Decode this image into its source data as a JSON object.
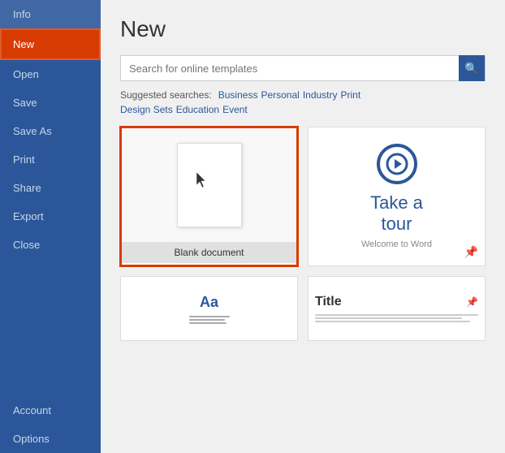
{
  "sidebar": {
    "items": [
      {
        "id": "info",
        "label": "Info",
        "active": false
      },
      {
        "id": "new",
        "label": "New",
        "active": true
      },
      {
        "id": "open",
        "label": "Open",
        "active": false
      },
      {
        "id": "save",
        "label": "Save",
        "active": false
      },
      {
        "id": "save-as",
        "label": "Save As",
        "active": false
      },
      {
        "id": "print",
        "label": "Print",
        "active": false
      },
      {
        "id": "share",
        "label": "Share",
        "active": false
      },
      {
        "id": "export",
        "label": "Export",
        "active": false
      },
      {
        "id": "close",
        "label": "Close",
        "active": false
      }
    ],
    "bottom_items": [
      {
        "id": "account",
        "label": "Account"
      },
      {
        "id": "options",
        "label": "Options"
      }
    ]
  },
  "main": {
    "page_title": "New",
    "search": {
      "placeholder": "Search for online templates",
      "search_icon": "🔍"
    },
    "suggested": {
      "label": "Suggested searches:",
      "links": [
        "Business",
        "Personal",
        "Industry",
        "Print",
        "Design Sets",
        "Education",
        "Event"
      ]
    },
    "templates": [
      {
        "id": "blank",
        "label": "Blank document",
        "selected": true
      },
      {
        "id": "tour",
        "label": "Welcome to Word",
        "title_line1": "Take a",
        "title_line2": "tour",
        "has_pin": true
      }
    ],
    "bottom_templates": [
      {
        "id": "word-template",
        "type": "aa"
      },
      {
        "id": "title-template",
        "type": "title",
        "title": "Title",
        "has_pin": true
      }
    ]
  },
  "colors": {
    "sidebar_bg": "#2b579a",
    "active_item": "#d83b01",
    "accent": "#2b579a"
  }
}
